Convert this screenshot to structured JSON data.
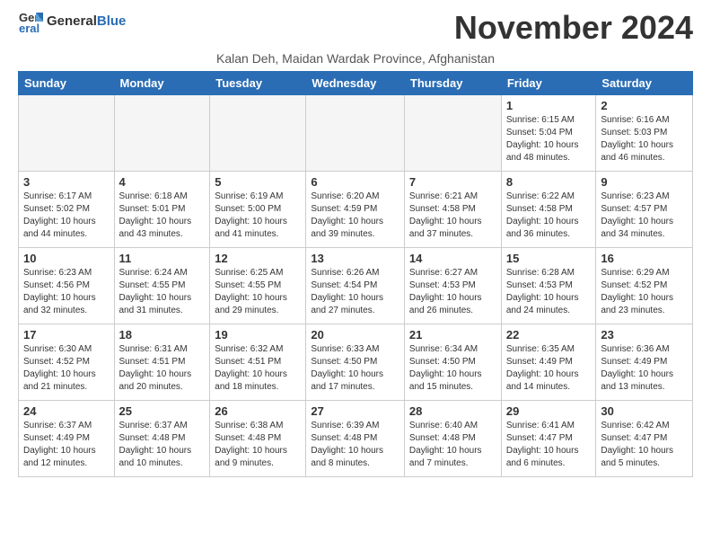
{
  "header": {
    "logo_general": "General",
    "logo_blue": "Blue",
    "month_title": "November 2024",
    "location": "Kalan Deh, Maidan Wardak Province, Afghanistan"
  },
  "weekdays": [
    "Sunday",
    "Monday",
    "Tuesday",
    "Wednesday",
    "Thursday",
    "Friday",
    "Saturday"
  ],
  "weeks": [
    [
      {
        "day": "",
        "info": ""
      },
      {
        "day": "",
        "info": ""
      },
      {
        "day": "",
        "info": ""
      },
      {
        "day": "",
        "info": ""
      },
      {
        "day": "",
        "info": ""
      },
      {
        "day": "1",
        "info": "Sunrise: 6:15 AM\nSunset: 5:04 PM\nDaylight: 10 hours and 48 minutes."
      },
      {
        "day": "2",
        "info": "Sunrise: 6:16 AM\nSunset: 5:03 PM\nDaylight: 10 hours and 46 minutes."
      }
    ],
    [
      {
        "day": "3",
        "info": "Sunrise: 6:17 AM\nSunset: 5:02 PM\nDaylight: 10 hours and 44 minutes."
      },
      {
        "day": "4",
        "info": "Sunrise: 6:18 AM\nSunset: 5:01 PM\nDaylight: 10 hours and 43 minutes."
      },
      {
        "day": "5",
        "info": "Sunrise: 6:19 AM\nSunset: 5:00 PM\nDaylight: 10 hours and 41 minutes."
      },
      {
        "day": "6",
        "info": "Sunrise: 6:20 AM\nSunset: 4:59 PM\nDaylight: 10 hours and 39 minutes."
      },
      {
        "day": "7",
        "info": "Sunrise: 6:21 AM\nSunset: 4:58 PM\nDaylight: 10 hours and 37 minutes."
      },
      {
        "day": "8",
        "info": "Sunrise: 6:22 AM\nSunset: 4:58 PM\nDaylight: 10 hours and 36 minutes."
      },
      {
        "day": "9",
        "info": "Sunrise: 6:23 AM\nSunset: 4:57 PM\nDaylight: 10 hours and 34 minutes."
      }
    ],
    [
      {
        "day": "10",
        "info": "Sunrise: 6:23 AM\nSunset: 4:56 PM\nDaylight: 10 hours and 32 minutes."
      },
      {
        "day": "11",
        "info": "Sunrise: 6:24 AM\nSunset: 4:55 PM\nDaylight: 10 hours and 31 minutes."
      },
      {
        "day": "12",
        "info": "Sunrise: 6:25 AM\nSunset: 4:55 PM\nDaylight: 10 hours and 29 minutes."
      },
      {
        "day": "13",
        "info": "Sunrise: 6:26 AM\nSunset: 4:54 PM\nDaylight: 10 hours and 27 minutes."
      },
      {
        "day": "14",
        "info": "Sunrise: 6:27 AM\nSunset: 4:53 PM\nDaylight: 10 hours and 26 minutes."
      },
      {
        "day": "15",
        "info": "Sunrise: 6:28 AM\nSunset: 4:53 PM\nDaylight: 10 hours and 24 minutes."
      },
      {
        "day": "16",
        "info": "Sunrise: 6:29 AM\nSunset: 4:52 PM\nDaylight: 10 hours and 23 minutes."
      }
    ],
    [
      {
        "day": "17",
        "info": "Sunrise: 6:30 AM\nSunset: 4:52 PM\nDaylight: 10 hours and 21 minutes."
      },
      {
        "day": "18",
        "info": "Sunrise: 6:31 AM\nSunset: 4:51 PM\nDaylight: 10 hours and 20 minutes."
      },
      {
        "day": "19",
        "info": "Sunrise: 6:32 AM\nSunset: 4:51 PM\nDaylight: 10 hours and 18 minutes."
      },
      {
        "day": "20",
        "info": "Sunrise: 6:33 AM\nSunset: 4:50 PM\nDaylight: 10 hours and 17 minutes."
      },
      {
        "day": "21",
        "info": "Sunrise: 6:34 AM\nSunset: 4:50 PM\nDaylight: 10 hours and 15 minutes."
      },
      {
        "day": "22",
        "info": "Sunrise: 6:35 AM\nSunset: 4:49 PM\nDaylight: 10 hours and 14 minutes."
      },
      {
        "day": "23",
        "info": "Sunrise: 6:36 AM\nSunset: 4:49 PM\nDaylight: 10 hours and 13 minutes."
      }
    ],
    [
      {
        "day": "24",
        "info": "Sunrise: 6:37 AM\nSunset: 4:49 PM\nDaylight: 10 hours and 12 minutes."
      },
      {
        "day": "25",
        "info": "Sunrise: 6:37 AM\nSunset: 4:48 PM\nDaylight: 10 hours and 10 minutes."
      },
      {
        "day": "26",
        "info": "Sunrise: 6:38 AM\nSunset: 4:48 PM\nDaylight: 10 hours and 9 minutes."
      },
      {
        "day": "27",
        "info": "Sunrise: 6:39 AM\nSunset: 4:48 PM\nDaylight: 10 hours and 8 minutes."
      },
      {
        "day": "28",
        "info": "Sunrise: 6:40 AM\nSunset: 4:48 PM\nDaylight: 10 hours and 7 minutes."
      },
      {
        "day": "29",
        "info": "Sunrise: 6:41 AM\nSunset: 4:47 PM\nDaylight: 10 hours and 6 minutes."
      },
      {
        "day": "30",
        "info": "Sunrise: 6:42 AM\nSunset: 4:47 PM\nDaylight: 10 hours and 5 minutes."
      }
    ]
  ]
}
